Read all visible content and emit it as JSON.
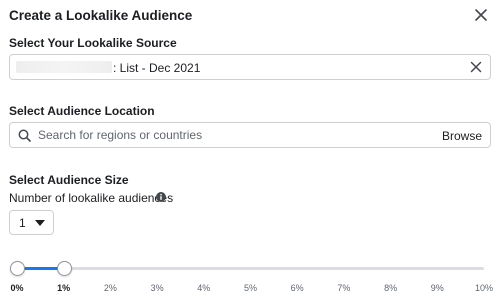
{
  "dialog": {
    "title": "Create a Lookalike Audience"
  },
  "source": {
    "label": "Select Your Lookalike Source",
    "value": ": List - Dec 2021"
  },
  "location": {
    "label": "Select Audience Location",
    "placeholder": "Search for regions or countries",
    "browse_label": "Browse"
  },
  "size": {
    "label": "Select Audience Size",
    "count_label": "Number of lookalike audiences",
    "count_value": "1",
    "slider": {
      "range_start_percent": 0,
      "range_end_percent": 1,
      "ticks": [
        "0%",
        "1%",
        "2%",
        "3%",
        "4%",
        "5%",
        "6%",
        "7%",
        "8%",
        "9%",
        "10%"
      ]
    }
  },
  "colors": {
    "accent": "#1877f2",
    "text": "#1c1e21",
    "muted": "#606770",
    "border": "#ccd0d5"
  },
  "icons": {
    "close": "close-icon",
    "clear": "clear-icon",
    "search": "search-icon",
    "info": "info-icon",
    "caret": "chevron-down-icon"
  }
}
